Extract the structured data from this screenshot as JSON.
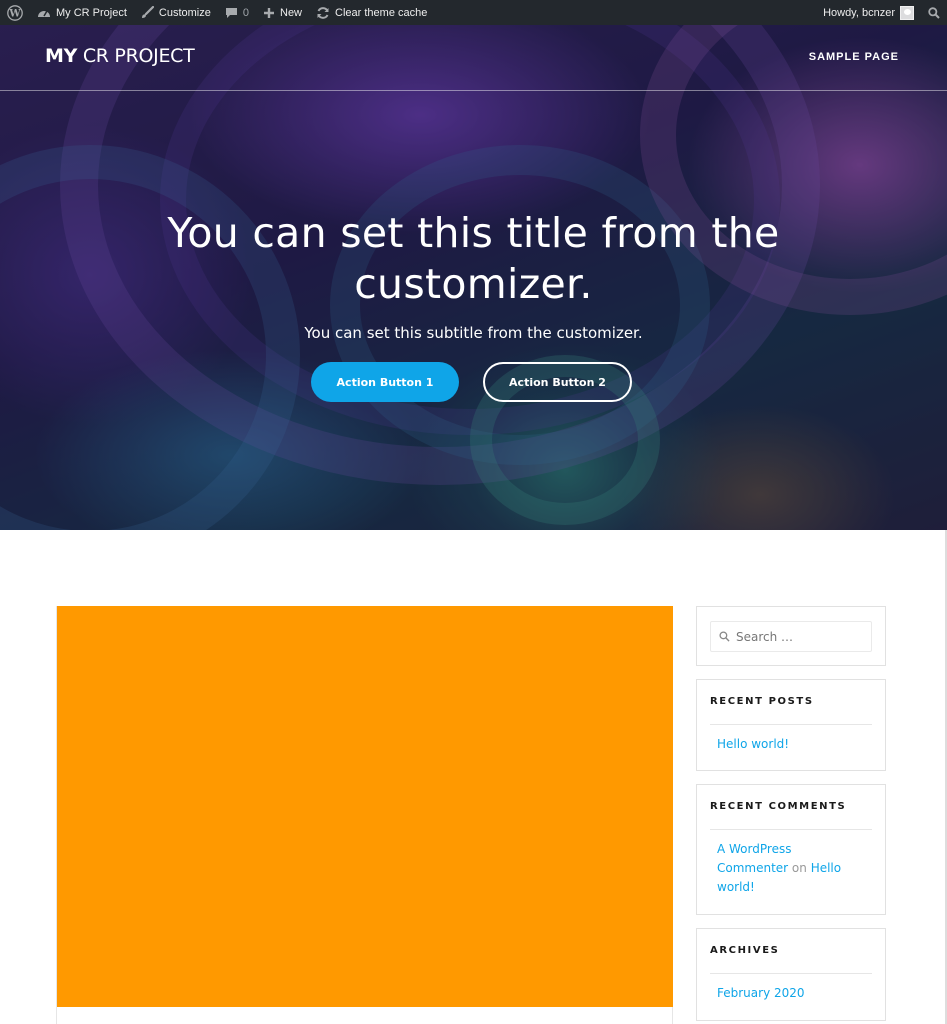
{
  "admin_bar": {
    "wp_logo": "wordpress-icon",
    "site_name": "My CR Project",
    "customize": "Customize",
    "comments_count": "0",
    "new": "New",
    "clear_cache": "Clear theme cache",
    "greeting": "Howdy, bcnzer"
  },
  "header": {
    "site_title_bold": "MY",
    "site_title_rest": "CR PROJECT",
    "menu": [
      "SAMPLE PAGE"
    ]
  },
  "hero": {
    "title": "You can set this title from the customizer.",
    "subtitle": "You can set this subtitle from the customizer.",
    "button_1": "Action Button 1",
    "button_2": "Action Button 2",
    "accent_color": "#0fa5e8"
  },
  "post": {
    "thumbnail_color": "#ff9900"
  },
  "sidebar": {
    "search": {
      "placeholder": "Search …"
    },
    "recent_posts": {
      "title": "RECENT POSTS",
      "items": [
        "Hello world!"
      ]
    },
    "recent_comments": {
      "title": "RECENT COMMENTS",
      "author": "A WordPress Commenter",
      "connector": " on ",
      "post": "Hello world!"
    },
    "archives": {
      "title": "ARCHIVES",
      "items": [
        "February 2020"
      ]
    }
  }
}
